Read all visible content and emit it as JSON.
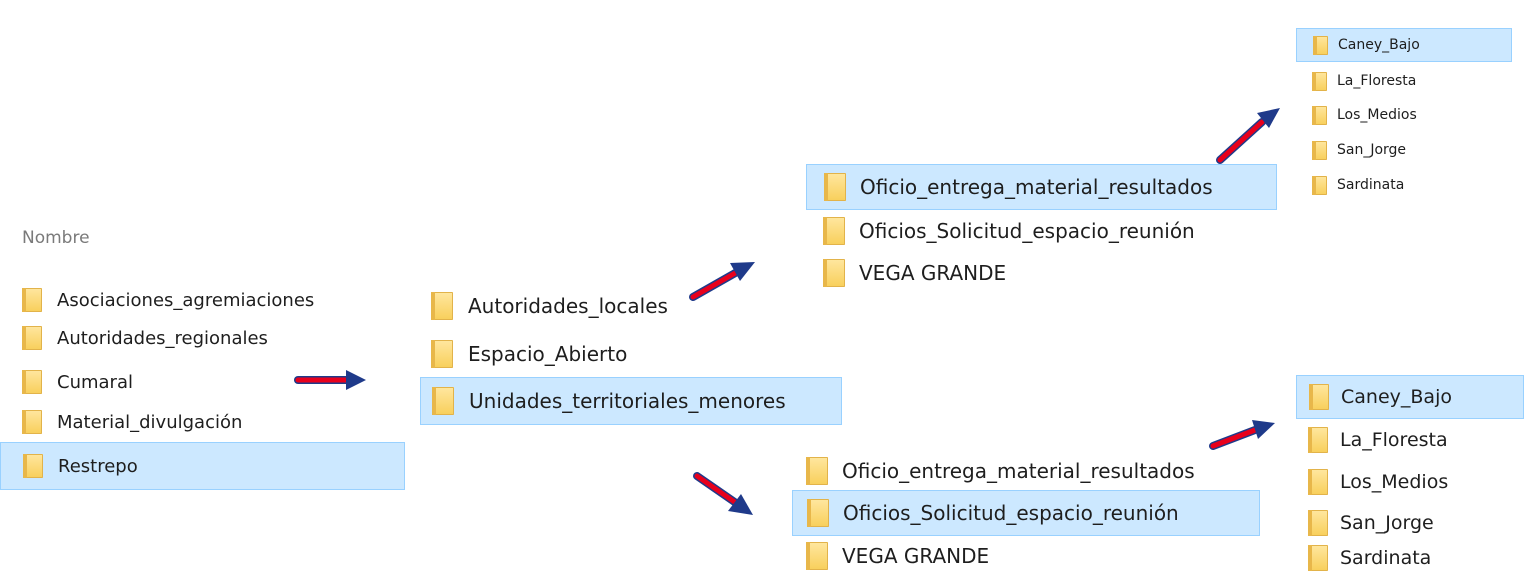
{
  "colors": {
    "selection_bg": "#cce8ff",
    "selection_border": "#99d1ff",
    "folder_yellow": "#f8cf5a",
    "arrow_red": "#e8001c",
    "arrow_outline": "#1f3a8a",
    "header_grey": "#7a7a7a"
  },
  "panel_a": {
    "header": "Nombre",
    "items": [
      {
        "label": "Asociaciones_agremiaciones",
        "icon": "folder-icon",
        "selected": false
      },
      {
        "label": "Autoridades_regionales",
        "icon": "folder-icon",
        "selected": false
      },
      {
        "label": "Cumaral",
        "icon": "folder-icon",
        "selected": false
      },
      {
        "label": "Material_divulgación",
        "icon": "folder-icon",
        "selected": false
      },
      {
        "label": "Restrepo",
        "icon": "folder-icon",
        "selected": true
      }
    ]
  },
  "panel_b": {
    "items": [
      {
        "label": "Autoridades_locales",
        "icon": "folder-icon",
        "selected": false
      },
      {
        "label": "Espacio_Abierto",
        "icon": "folder-icon",
        "selected": false
      },
      {
        "label": "Unidades_territoriales_menores",
        "icon": "folder-icon",
        "selected": true
      }
    ]
  },
  "panel_c": {
    "items": [
      {
        "label": "Oficio_entrega_material_resultados",
        "icon": "folder-icon",
        "selected": true
      },
      {
        "label": "Oficios_Solicitud_espacio_reunión",
        "icon": "folder-icon",
        "selected": false
      },
      {
        "label": "VEGA GRANDE",
        "icon": "folder-icon",
        "selected": false
      }
    ]
  },
  "panel_d": {
    "items": [
      {
        "label": "Oficio_entrega_material_resultados",
        "icon": "folder-icon",
        "selected": false
      },
      {
        "label": "Oficios_Solicitud_espacio_reunión",
        "icon": "folder-icon",
        "selected": true
      },
      {
        "label": "VEGA GRANDE",
        "icon": "folder-icon",
        "selected": false
      }
    ]
  },
  "panel_e": {
    "items": [
      {
        "label": "Caney_Bajo",
        "icon": "folder-icon",
        "selected": true
      },
      {
        "label": "La_Floresta",
        "icon": "folder-icon",
        "selected": false
      },
      {
        "label": "Los_Medios",
        "icon": "folder-icon",
        "selected": false
      },
      {
        "label": "San_Jorge",
        "icon": "folder-icon",
        "selected": false
      },
      {
        "label": "Sardinata",
        "icon": "folder-icon",
        "selected": false
      }
    ]
  },
  "panel_f": {
    "items": [
      {
        "label": "Caney_Bajo",
        "icon": "folder-icon",
        "selected": true
      },
      {
        "label": "La_Floresta",
        "icon": "folder-icon",
        "selected": false
      },
      {
        "label": "Los_Medios",
        "icon": "folder-icon",
        "selected": false
      },
      {
        "label": "San_Jorge",
        "icon": "folder-icon",
        "selected": false
      },
      {
        "label": "Sardinata",
        "icon": "folder-icon",
        "selected": false
      }
    ]
  },
  "arrows": [
    {
      "name": "arrow-a-to-b",
      "icon": "right-arrow-icon"
    },
    {
      "name": "arrow-b-to-c",
      "icon": "right-arrow-icon"
    },
    {
      "name": "arrow-b-to-d",
      "icon": "right-arrow-icon"
    },
    {
      "name": "arrow-c-to-e",
      "icon": "right-arrow-icon"
    },
    {
      "name": "arrow-d-to-f",
      "icon": "right-arrow-icon"
    }
  ]
}
